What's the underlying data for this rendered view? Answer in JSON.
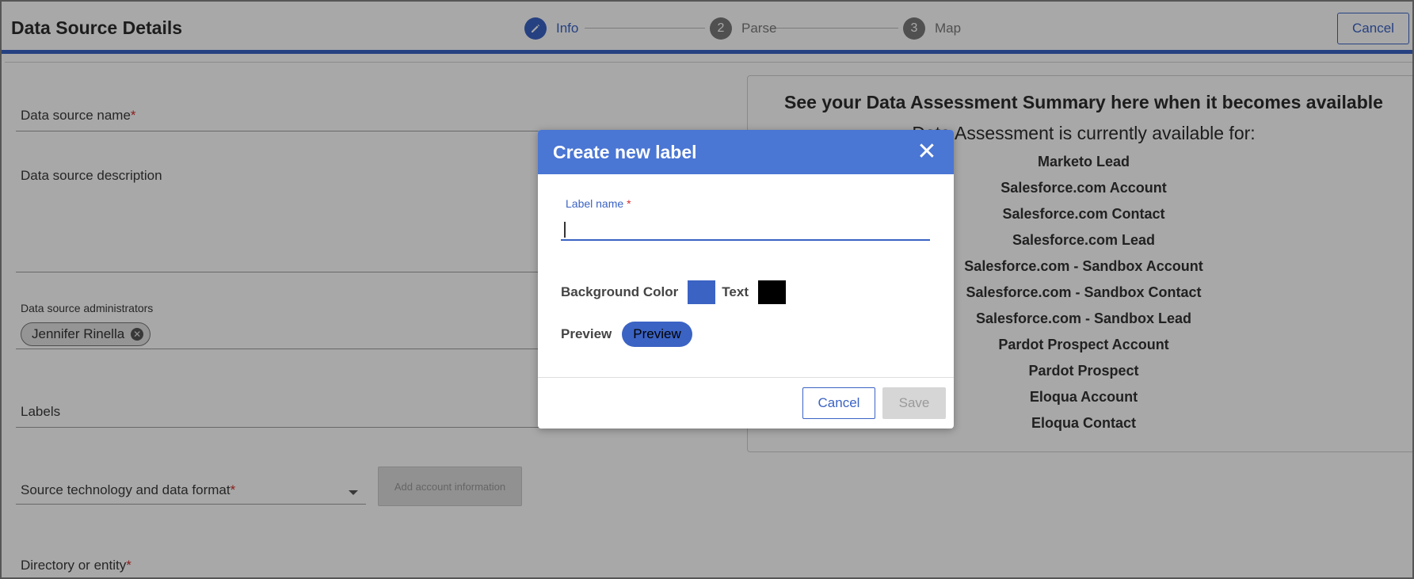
{
  "header": {
    "title": "Data Source Details",
    "cancel_label": "Cancel",
    "steps": [
      {
        "number": "",
        "label": "Info",
        "icon": "pencil-icon"
      },
      {
        "number": "2",
        "label": "Parse"
      },
      {
        "number": "3",
        "label": "Map"
      }
    ]
  },
  "form": {
    "name_label": "Data source name",
    "description_label": "Data source description",
    "administrators_label": "Data source administrators",
    "administrators": [
      {
        "name": "Jennifer Rinella"
      }
    ],
    "labels_label": "Labels",
    "source_technology_label": "Source technology and data format",
    "add_account_label": "Add account information",
    "directory_label": "Directory or entity",
    "required_marker": "*"
  },
  "summary": {
    "title": "See your Data Assessment Summary here when it becomes available",
    "subtitle": "Data Assessment is currently available for:",
    "items": [
      "Marketo Lead",
      "Salesforce.com Account",
      "Salesforce.com Contact",
      "Salesforce.com Lead",
      "Salesforce.com - Sandbox Account",
      "Salesforce.com - Sandbox Contact",
      "Salesforce.com - Sandbox Lead",
      "Pardot Prospect Account",
      "Pardot Prospect",
      "Eloqua Account",
      "Eloqua Contact"
    ]
  },
  "modal": {
    "title": "Create new label",
    "label_name_label": "Label name",
    "required_marker": "*",
    "label_name_value": "",
    "background_color_label": "Background Color",
    "background_color": "#3b63c4",
    "text_color_label": "Text",
    "text_color": "#000000",
    "preview_label": "Preview",
    "preview_pill_text": "Preview",
    "cancel_label": "Cancel",
    "save_label": "Save"
  },
  "colors": {
    "accent": "#3b63c4",
    "modal_header": "#4a76d4",
    "required": "#d32f2f"
  }
}
